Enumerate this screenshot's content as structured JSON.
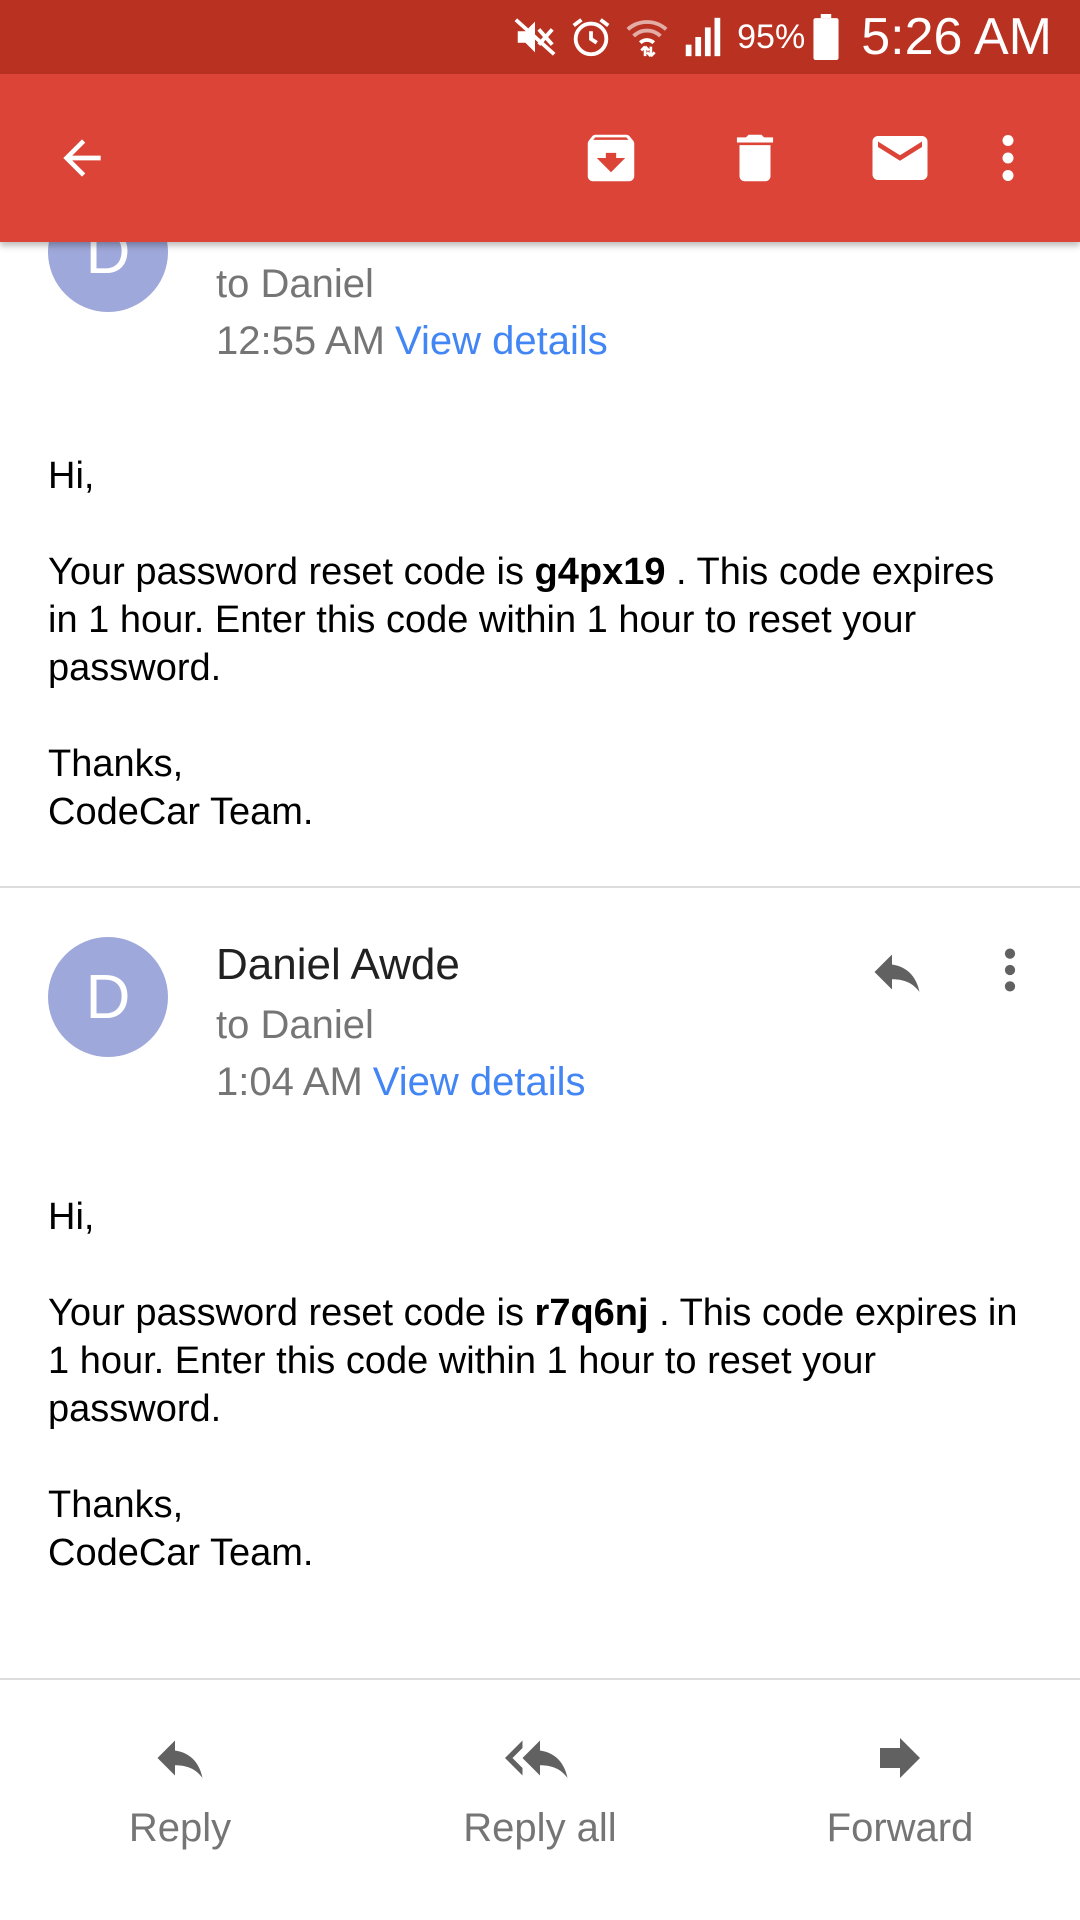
{
  "status_bar": {
    "battery_percent": "95%",
    "time": "5:26 AM",
    "icons": [
      "mute-icon",
      "alarm-icon",
      "wifi-icon",
      "signal-icon",
      "battery-icon"
    ]
  },
  "toolbar": {
    "icons": [
      "back-arrow-icon",
      "archive-icon",
      "delete-icon",
      "mail-icon",
      "more-vert-icon"
    ]
  },
  "messages": [
    {
      "avatar_letter": "D",
      "to": "to Daniel",
      "time": "12:55 AM",
      "view_details": "View details",
      "greeting": "Hi,",
      "line_prefix": "Your password reset code is ",
      "code": "g4px19",
      "line_suffix": " . This code expires in 1 hour. Enter this code within 1 hour to reset your password.",
      "thanks": "Thanks,",
      "signature": "CodeCar Team."
    },
    {
      "avatar_letter": "D",
      "sender": "Daniel Awde",
      "to": "to Daniel",
      "time": "1:04 AM",
      "view_details": "View details",
      "greeting": "Hi,",
      "line_prefix": "Your password reset code is ",
      "code": "r7q6nj",
      "line_suffix": " . This code expires in 1 hour. Enter this code within 1 hour to reset your password.",
      "thanks": "Thanks,",
      "signature": "CodeCar Team."
    }
  ],
  "actions": {
    "reply": "Reply",
    "reply_all": "Reply all",
    "forward": "Forward"
  },
  "colors": {
    "status_bar": "#b93221",
    "toolbar": "#db4437",
    "avatar": "#9fa8da",
    "link": "#4285f4"
  }
}
